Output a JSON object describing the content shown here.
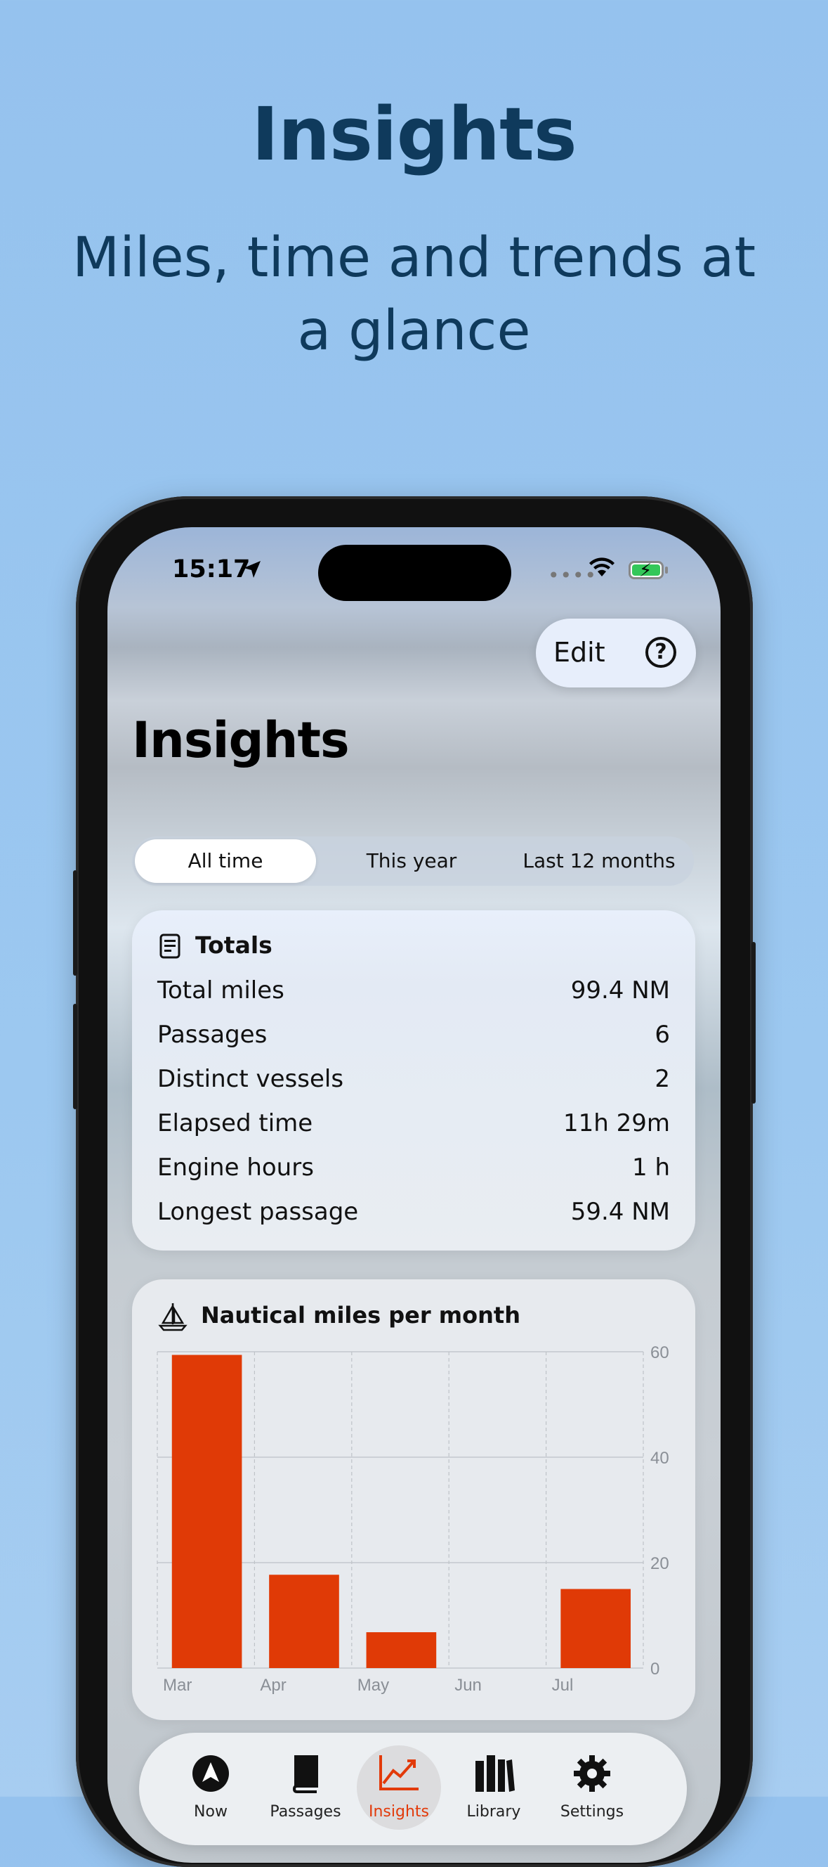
{
  "promo": {
    "title": "Insights",
    "subtitle": "Miles, time and trends at a glance"
  },
  "status_bar": {
    "time": "15:17"
  },
  "toolbar": {
    "edit_label": "Edit",
    "help_icon": "question-circle-icon"
  },
  "screen": {
    "title": "Insights"
  },
  "segments": [
    {
      "label": "All time",
      "selected": true
    },
    {
      "label": "This year",
      "selected": false
    },
    {
      "label": "Last 12 months",
      "selected": false
    }
  ],
  "totals": {
    "title": "Totals",
    "rows": [
      {
        "label": "Total miles",
        "value": "99.4 NM"
      },
      {
        "label": "Passages",
        "value": "6"
      },
      {
        "label": "Distinct vessels",
        "value": "2"
      },
      {
        "label": "Elapsed time",
        "value": "11h 29m"
      },
      {
        "label": "Engine hours",
        "value": "1 h"
      },
      {
        "label": "Longest passage",
        "value": "59.4 NM"
      }
    ]
  },
  "chart_card": {
    "title": "Nautical miles per month"
  },
  "chart_data": {
    "type": "bar",
    "categories": [
      "Mar",
      "Apr",
      "May",
      "Jun",
      "Jul"
    ],
    "values": [
      59.4,
      17.7,
      6.8,
      0,
      15.0
    ],
    "ylim": [
      0,
      60
    ],
    "yticks": [
      "0",
      "20",
      "40",
      "60"
    ],
    "bar_color": "#e03a06",
    "axis_side": "right",
    "grid": true
  },
  "tabbar": {
    "items": [
      {
        "icon": "navigation-arrow-icon",
        "label": "Now",
        "active": false
      },
      {
        "icon": "book-icon",
        "label": "Passages",
        "active": false
      },
      {
        "icon": "chart-line-icon",
        "label": "Insights",
        "active": true
      },
      {
        "icon": "library-icon",
        "label": "Library",
        "active": false
      },
      {
        "icon": "gear-icon",
        "label": "Settings",
        "active": false
      }
    ]
  },
  "colors": {
    "accent": "#e23a0a",
    "promo_text": "#0f3a5c"
  }
}
